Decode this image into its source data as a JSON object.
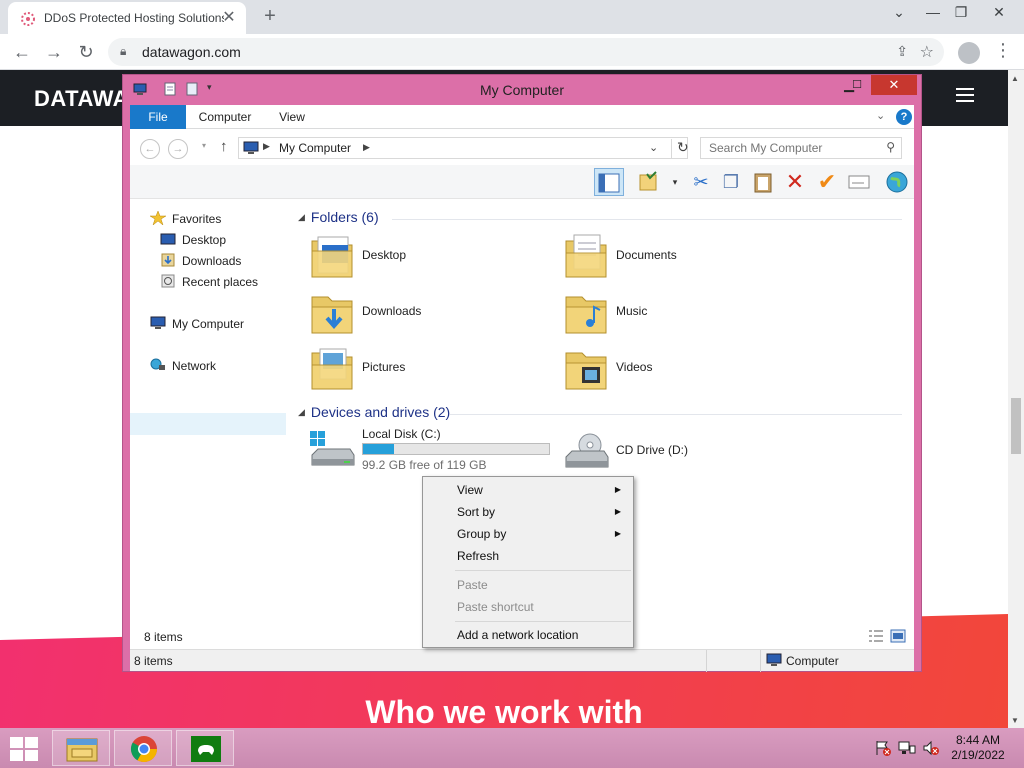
{
  "browser": {
    "tab_title": "DDoS Protected Hosting Solutions",
    "url": "datawagon.com"
  },
  "website": {
    "logo": "DATAWA",
    "heading": "Who we work with"
  },
  "explorer": {
    "window_title": "My Computer",
    "ribbon_tabs": [
      "File",
      "Computer",
      "View"
    ],
    "address_crumb": "My Computer",
    "search_placeholder": "Search My Computer",
    "nav": {
      "favorites": "Favorites",
      "desktop": "Desktop",
      "downloads": "Downloads",
      "recent_places": "Recent places",
      "my_computer": "My Computer",
      "network": "Network"
    },
    "folders_header": "Folders (6)",
    "folders": [
      "Desktop",
      "Documents",
      "Downloads",
      "Music",
      "Pictures",
      "Videos"
    ],
    "devices_header": "Devices and drives (2)",
    "drives": {
      "local_name": "Local Disk (C:)",
      "local_free": "99.2 GB free of 119 GB",
      "local_used_fraction": 0.166,
      "cd_name": "CD Drive (D:)"
    },
    "inner_status": "8 items",
    "status_count": "8 items",
    "status_location": "Computer"
  },
  "context_menu": {
    "view": "View",
    "sort_by": "Sort by",
    "group_by": "Group by",
    "refresh": "Refresh",
    "paste": "Paste",
    "paste_shortcut": "Paste shortcut",
    "add_network_location": "Add a network location"
  },
  "clock": {
    "time": "8:44 AM",
    "date": "2/19/2022"
  },
  "colors": {
    "window_frame": "#dc6fa8",
    "file_tab": "#1979ca",
    "close_button": "#c7372f",
    "drive_fill": "#26a0da",
    "taskbar": "#d99cc0"
  }
}
